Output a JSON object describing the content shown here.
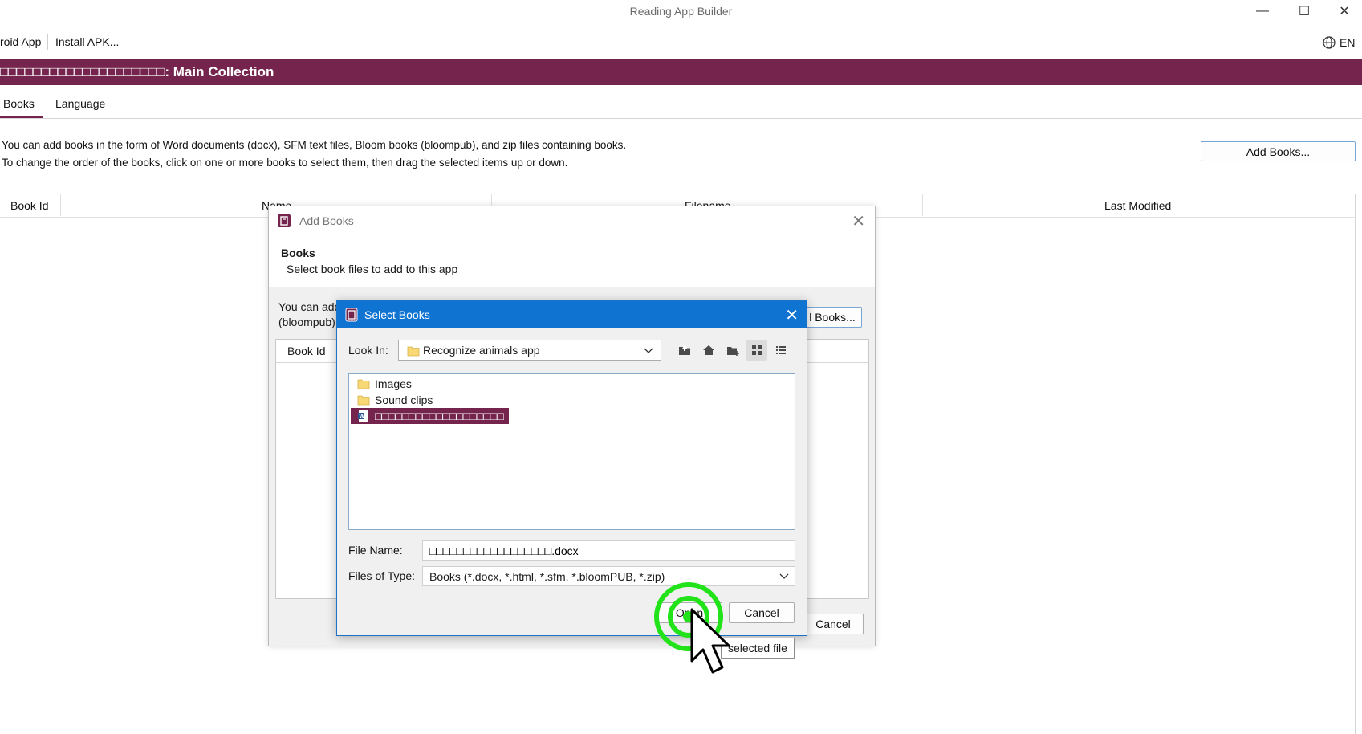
{
  "window": {
    "title": "Reading App Builder",
    "minimize": "—",
    "maximize": "☐",
    "close": "✕"
  },
  "menu": {
    "items": [
      "roid App",
      "Install APK..."
    ],
    "language": "EN"
  },
  "collection": {
    "banner": "□□□□□□□□□□□□□□□□□□□□: Main Collection"
  },
  "tabs": [
    "Books",
    "Language"
  ],
  "books_tab": {
    "info_line1": "You can add books in the form of Word documents (docx), SFM text files, Bloom books (bloompub), and zip files containing books.",
    "info_line2": "To change the order of the books, click on one or more books to select them, then drag the selected items up or down.",
    "add_books_label": "Add Books...",
    "columns": [
      "Book Id",
      "Name",
      "Filename",
      "Last Modified"
    ]
  },
  "add_books_dialog": {
    "title": "Add Books",
    "heading": "Books",
    "subheading": "Select book files to add to this app",
    "partial_line1": "You can add",
    "partial_line2": "(bloompub)",
    "partial_button": "l Books...",
    "column_book_id": "Book Id",
    "cancel_label": "Cancel"
  },
  "select_books_dialog": {
    "title": "Select Books",
    "look_in_label": "Look In:",
    "look_in_value": "Recognize animals app",
    "files": [
      {
        "name": "Images",
        "type": "folder",
        "selected": false
      },
      {
        "name": "Sound clips",
        "type": "folder",
        "selected": false
      },
      {
        "name": "□□□□□□□□□□□□□□□□□□□",
        "type": "word-doc",
        "selected": true
      }
    ],
    "file_name_label": "File Name:",
    "file_name_value": "□□□□□□□□□□□□□□□□□□.docx",
    "files_of_type_label": "Files of Type:",
    "files_of_type_value": "Books (*.docx, *.html, *.sfm, *.bloomPUB, *.zip)",
    "open_label": "Open",
    "cancel_label": "Cancel"
  },
  "tooltip": "selected file",
  "colors": {
    "brand": "#74244d",
    "dialog_title": "#0f74d1",
    "click_ring": "#22e31a"
  }
}
